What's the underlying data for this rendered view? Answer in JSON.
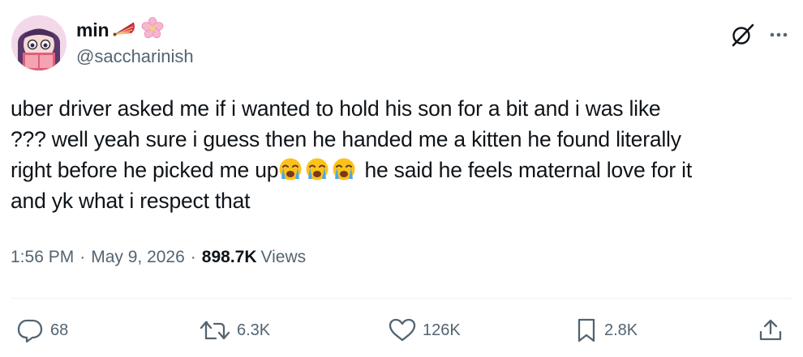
{
  "author": {
    "display_name": "min",
    "handle": "@saccharinish"
  },
  "tweet": {
    "lines": [
      "uber driver asked me if i wanted to hold his son for a bit and i was like",
      "??? well yeah sure i guess then he handed me a kitten he found literally",
      "right before he picked me up",
      " he said he feels maternal love for it",
      "and yk what i respect that"
    ]
  },
  "meta": {
    "time": "1:56 PM",
    "separator": "·",
    "date": "May 9, 2026",
    "views_count": "898.7K",
    "views_label": "Views"
  },
  "actions": {
    "replies": "68",
    "reposts": "6.3K",
    "likes": "126K",
    "bookmarks": "2.8K"
  },
  "colors": {
    "text": "#0f1419",
    "secondary": "#536471",
    "divider": "#eff3f4"
  },
  "icons": [
    "grok-icon",
    "more-icon",
    "reply-icon",
    "repost-icon",
    "like-icon",
    "bookmark-icon",
    "share-icon",
    "loudly-crying-face-emoji",
    "fan-emoji",
    "cherry-blossom-emoji"
  ]
}
